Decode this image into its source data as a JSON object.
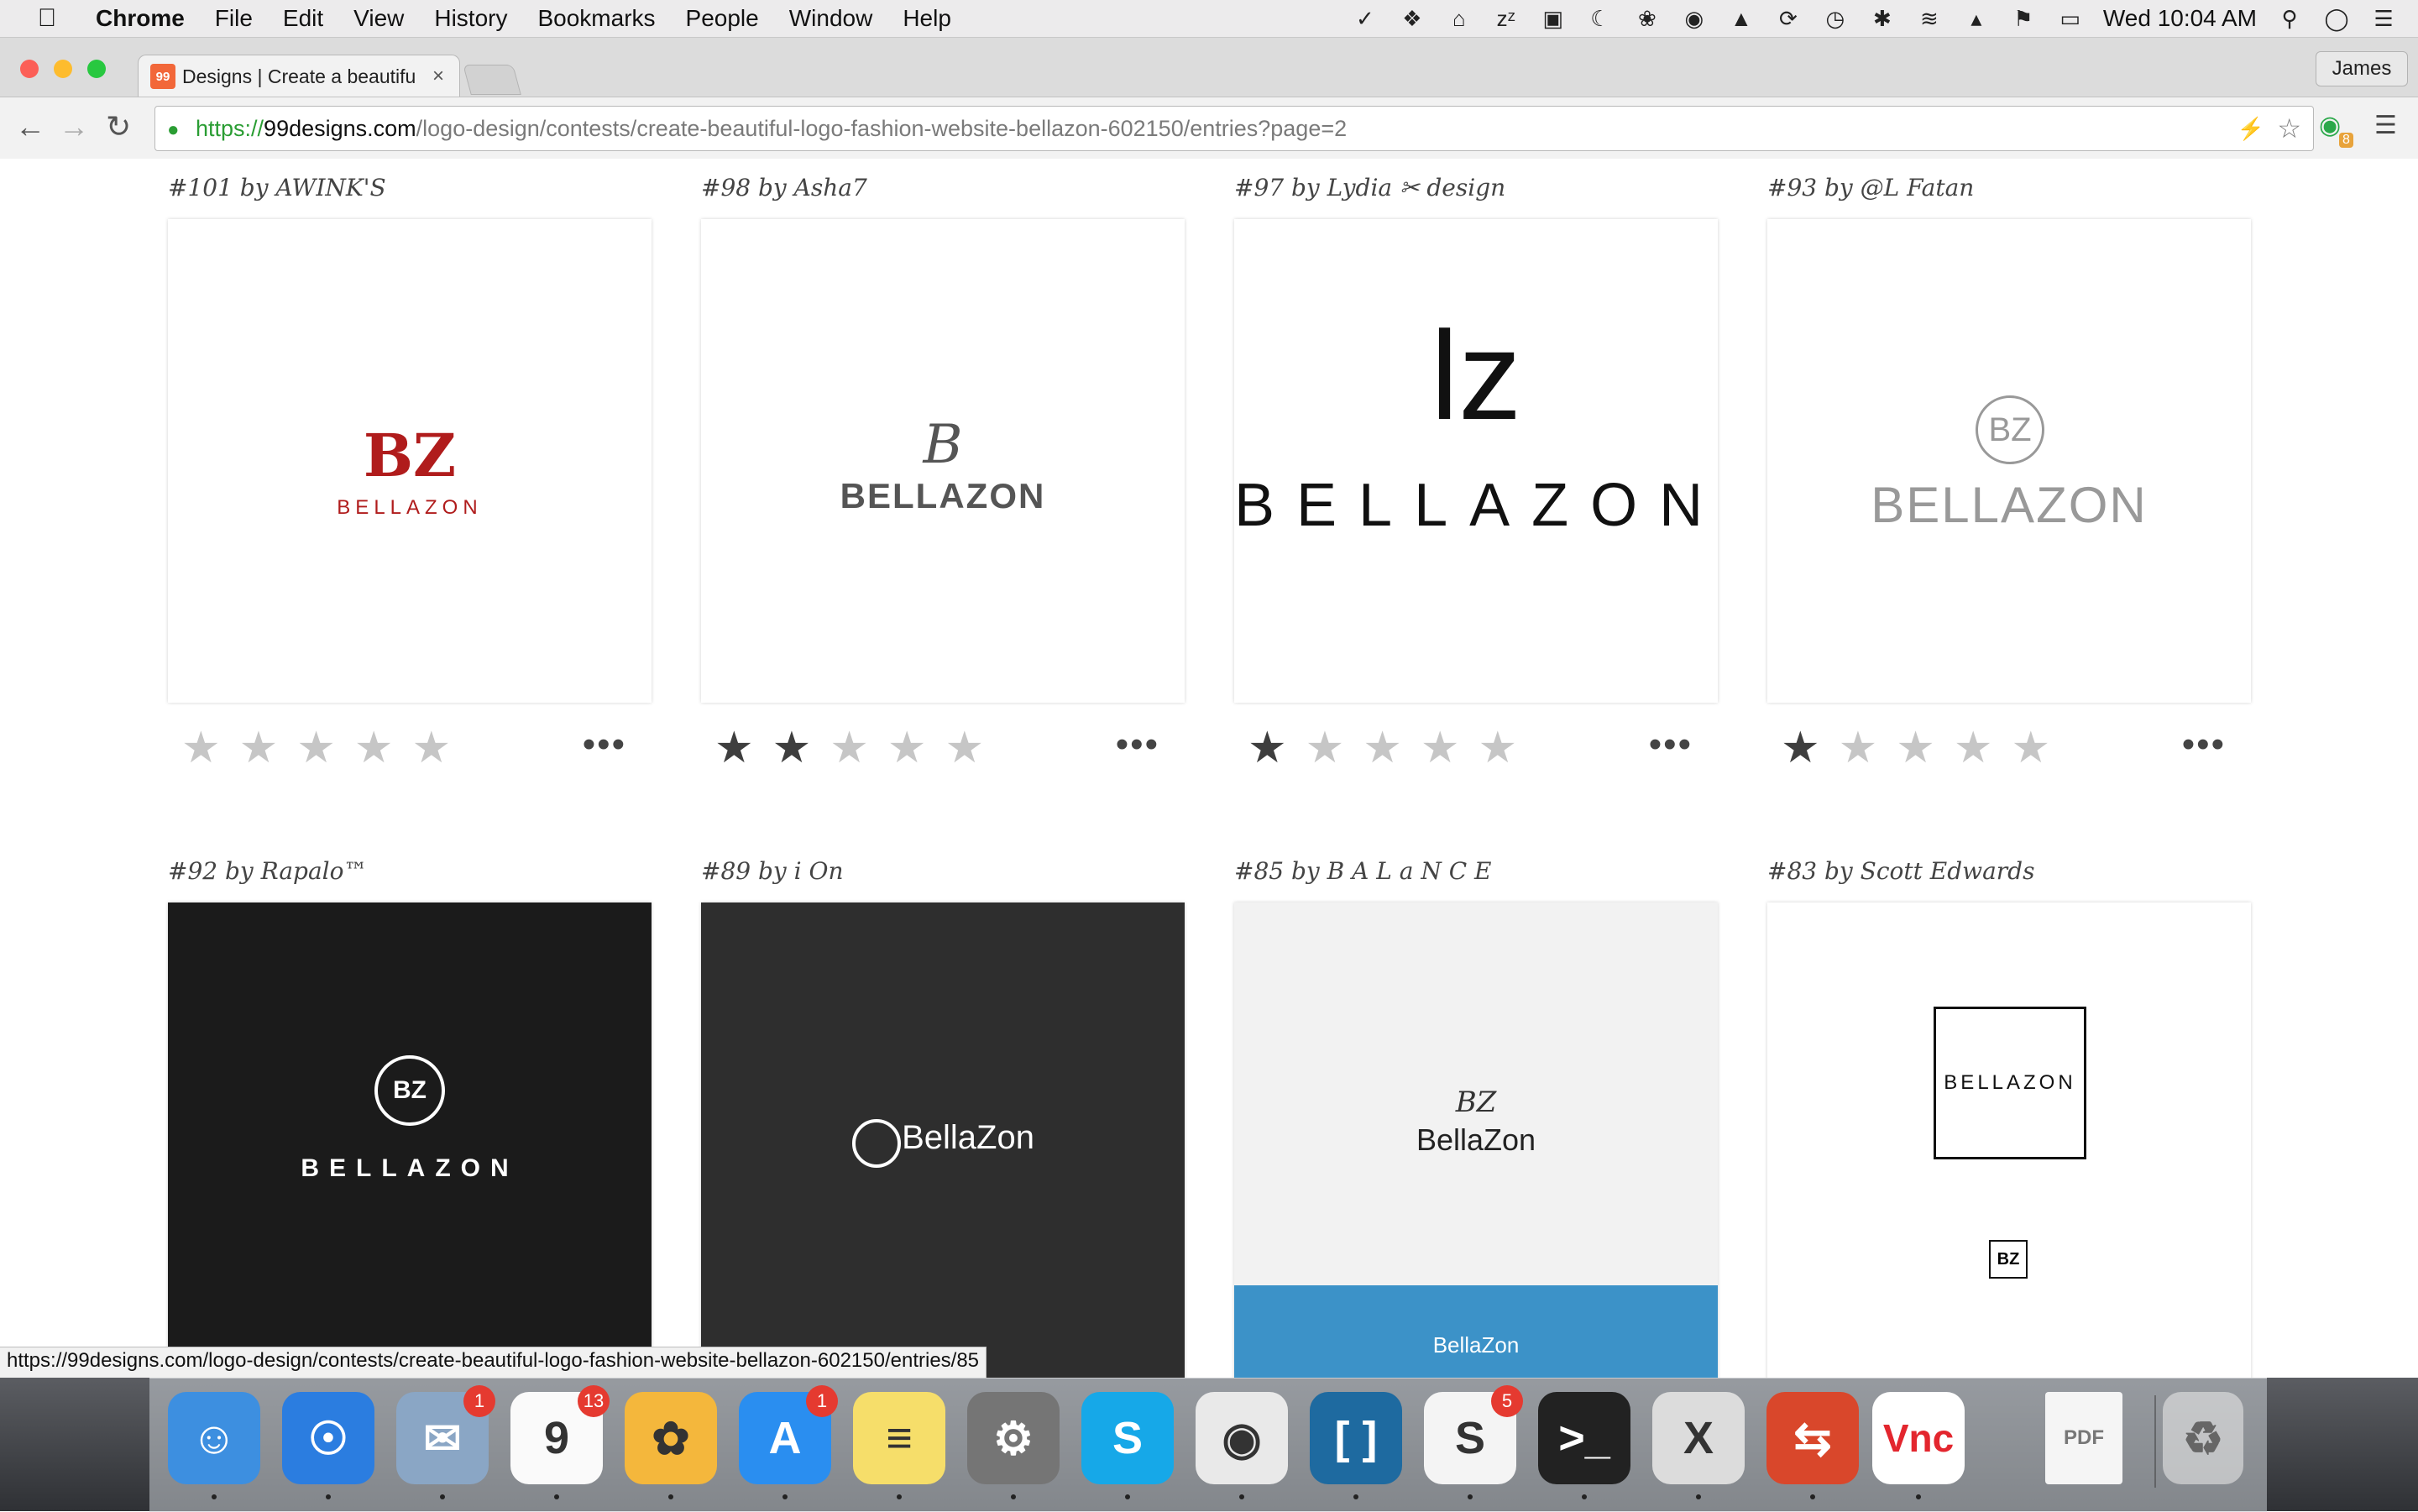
{
  "menubar": {
    "app": "Chrome",
    "items": [
      "File",
      "Edit",
      "View",
      "History",
      "Bookmarks",
      "People",
      "Window",
      "Help"
    ],
    "clock": "Wed 10:04 AM"
  },
  "browser": {
    "tab_title": "Designs | Create a beautifu",
    "tab_favicon": "99",
    "profile": "James",
    "url_scheme": "https://",
    "url_host": "99designs.com",
    "url_path": "/logo-design/contests/create-beautiful-logo-fashion-website-bellazon-602150/entries?page=2",
    "extension_badge": "8"
  },
  "entries": [
    {
      "title": "#101 by AWINK'S",
      "rating": 0,
      "bg": "#ffffff",
      "logo_mark": "BZ",
      "logo_text": "BELLAZON"
    },
    {
      "title": "#98 by Asha7",
      "rating": 2,
      "bg": "#ffffff",
      "logo_mark": "B",
      "logo_text": "BELLAZON"
    },
    {
      "title": "#97 by Lydia ✂ design",
      "rating": 1,
      "bg": "#ffffff",
      "logo_mark": "lz",
      "logo_text": "BELLAZON"
    },
    {
      "title": "#93 by @L Fatan",
      "rating": 1,
      "bg": "#ffffff",
      "logo_mark": "BZ",
      "logo_text": "BELLAZON"
    },
    {
      "title": "#92 by Rapalo™",
      "rating": null,
      "bg": "#1b1b1b",
      "logo_mark": "BZ",
      "logo_text": "BELLAZON"
    },
    {
      "title": "#89 by i On",
      "rating": null,
      "bg": "#2e2e2e",
      "logo_mark": "",
      "logo_text": "BellaZon"
    },
    {
      "title": "#85 by B A L a N C E",
      "rating": null,
      "bg": "#f2f2f2",
      "logo_mark": "BZ",
      "logo_text": "BellaZon"
    },
    {
      "title": "#83 by Scott Edwards",
      "rating": null,
      "bg": "#ffffff",
      "logo_mark": "BZ",
      "logo_text": "BELLAZON"
    }
  ],
  "status_url": "https://99designs.com/logo-design/contests/create-beautiful-logo-fashion-website-bellazon-602150/entries/85",
  "dock": [
    {
      "name": "finder",
      "color": "#3d8fe0",
      "glyph": "☺",
      "badge": ""
    },
    {
      "name": "safari",
      "color": "#2b7de0",
      "glyph": "☉",
      "badge": ""
    },
    {
      "name": "mail",
      "color": "#8aa6c5",
      "glyph": "✉",
      "badge": "1"
    },
    {
      "name": "calendar",
      "color": "#fafafa",
      "glyph": "9",
      "badge": "13"
    },
    {
      "name": "photos",
      "color": "#f4b73c",
      "glyph": "✿",
      "badge": ""
    },
    {
      "name": "app-store",
      "color": "#2a8ef0",
      "glyph": "A",
      "badge": "1"
    },
    {
      "name": "notes",
      "color": "#f6de6a",
      "glyph": "≡",
      "badge": ""
    },
    {
      "name": "system-preferences",
      "color": "#757575",
      "glyph": "⚙",
      "badge": ""
    },
    {
      "name": "skype",
      "color": "#16a8e8",
      "glyph": "S",
      "badge": ""
    },
    {
      "name": "chrome",
      "color": "#e9e9e9",
      "glyph": "◉",
      "badge": ""
    },
    {
      "name": "brackets",
      "color": "#1e6aa0",
      "glyph": "[ ]",
      "badge": ""
    },
    {
      "name": "slack",
      "color": "#f4f4f4",
      "glyph": "S",
      "badge": "5"
    },
    {
      "name": "terminal",
      "color": "#222222",
      "glyph": ">_",
      "badge": ""
    },
    {
      "name": "x11",
      "color": "#dcdcdc",
      "glyph": "X",
      "badge": ""
    },
    {
      "name": "remote-desktop",
      "color": "#d9472b",
      "glyph": "⇆",
      "badge": ""
    },
    {
      "name": "vnc-viewer",
      "color": "#ffffff",
      "glyph": "Vnc",
      "badge": ""
    }
  ],
  "dock_docs": {
    "label": "PDF"
  },
  "colors": {
    "star_on": "#3e3e3e",
    "star_off": "#c6c6c6"
  }
}
